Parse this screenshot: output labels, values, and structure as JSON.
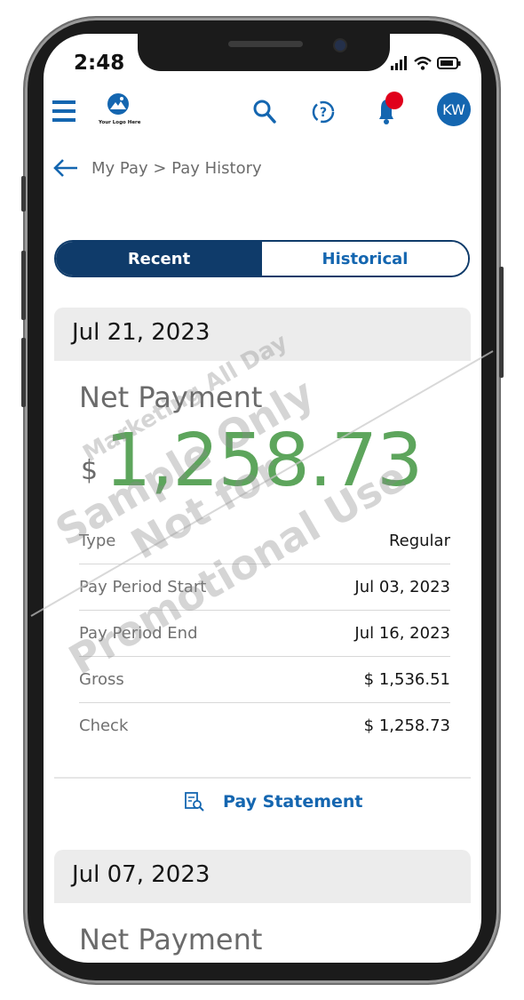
{
  "status_bar": {
    "time": "2:48"
  },
  "header": {
    "logo_text": "Your Logo Here",
    "avatar_initials": "KW"
  },
  "breadcrumb": {
    "text": "My Pay > Pay History"
  },
  "tabs": [
    {
      "label": "Recent",
      "selected": true
    },
    {
      "label": "Historical",
      "selected": false
    }
  ],
  "payments": [
    {
      "date": "Jul 21, 2023",
      "net_label": "Net Payment",
      "currency": "$",
      "net_amount": "1,258.73",
      "rows": [
        {
          "label": "Type",
          "value": "Regular"
        },
        {
          "label": "Pay Period Start",
          "value": "Jul 03, 2023"
        },
        {
          "label": "Pay Period End",
          "value": "Jul 16, 2023"
        },
        {
          "label": "Gross",
          "value": "$ 1,536.51"
        },
        {
          "label": "Check",
          "value": "$ 1,258.73"
        }
      ],
      "statement_label": "Pay Statement"
    },
    {
      "date": "Jul 07, 2023",
      "net_label": "Net Payment"
    }
  ],
  "watermark": {
    "line1": "Marketing All Day",
    "line2": "Sample Only",
    "line3": "Not for",
    "line4": "Promotional Use"
  },
  "colors": {
    "navy": "#0f3b6a",
    "blue": "#1466b0",
    "green": "#5da55c",
    "badge": "#e0001b"
  }
}
